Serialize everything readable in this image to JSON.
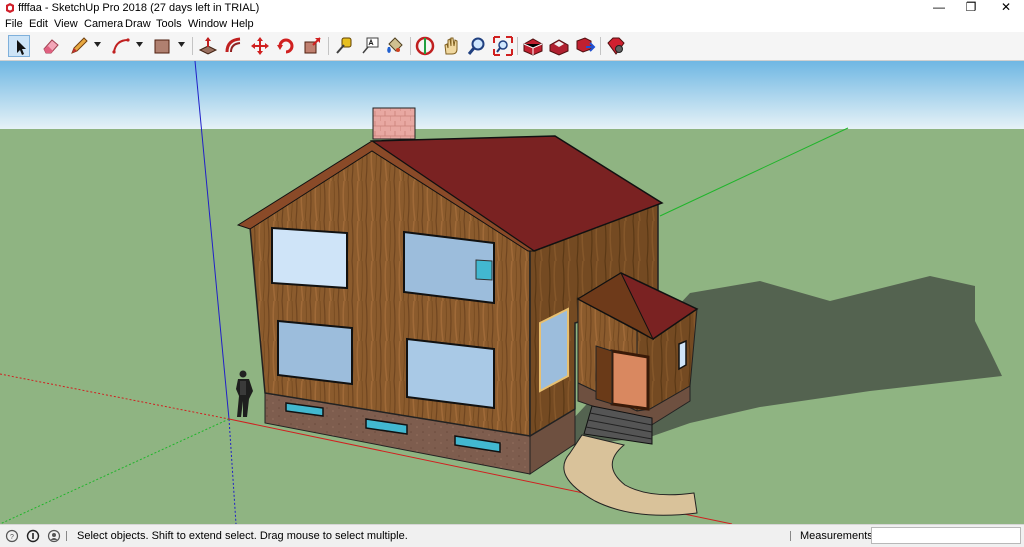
{
  "window": {
    "title": "ffffaa - SketchUp Pro 2018 (27 days left in TRIAL)",
    "minimize_glyph": "—",
    "restore_glyph": "❐",
    "close_glyph": "✕"
  },
  "menu": {
    "items": [
      "File",
      "Edit",
      "View",
      "Camera",
      "Draw",
      "Tools",
      "Window",
      "Help"
    ]
  },
  "toolbar": {
    "tools": [
      {
        "icon": "select-arrow-icon",
        "active": true
      },
      {
        "icon": "eraser-icon"
      },
      {
        "icon": "line-pencil-icon",
        "dropdown": true
      },
      {
        "icon": "arc-icon",
        "dropdown": true
      },
      {
        "icon": "rectangle-icon",
        "dropdown": true
      },
      {
        "icon": "push-pull-icon"
      },
      {
        "icon": "offset-icon"
      },
      {
        "icon": "move-icon"
      },
      {
        "icon": "rotate-icon"
      },
      {
        "icon": "scale-icon"
      },
      {
        "icon": "tape-measure-icon"
      },
      {
        "icon": "text-icon"
      },
      {
        "icon": "paint-bucket-icon"
      },
      {
        "icon": "orbit-icon"
      },
      {
        "icon": "pan-icon"
      },
      {
        "icon": "zoom-icon"
      },
      {
        "icon": "zoom-extents-icon"
      },
      {
        "icon": "3d-warehouse-icon"
      },
      {
        "icon": "extension-warehouse-icon"
      },
      {
        "icon": "send-to-layout-icon"
      },
      {
        "icon": "extension-manager-icon"
      }
    ]
  },
  "status": {
    "text": "Select objects. Shift to extend select. Drag mouse to select multiple.",
    "measurements_label": "Measurements",
    "measurements_value": ""
  },
  "colors": {
    "sky_top": "#6fb7e3",
    "sky_bottom": "#e6f2f7",
    "ground": "#8fb482",
    "roof": "#7a2222",
    "wood": "#8a5a2c",
    "foundation": "#7d5c4c",
    "glass": "#a9c9e6",
    "basement_glass": "#42b8d0",
    "chimney": "#e6a6a0",
    "path": "#d9c29a",
    "shadow": "#4e5a4a",
    "red_axis": "#d02020",
    "green_axis": "#1fb52a",
    "blue_axis": "#2020c8"
  }
}
